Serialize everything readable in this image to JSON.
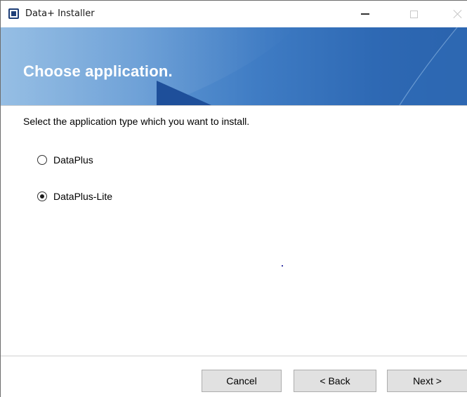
{
  "window": {
    "title": "Data+ Installer"
  },
  "banner": {
    "title": "Choose application."
  },
  "content": {
    "instruction": "Select the application type which you want to install.",
    "options": [
      {
        "label": "DataPlus",
        "selected": false
      },
      {
        "label": "DataPlus-Lite",
        "selected": true
      }
    ]
  },
  "footer": {
    "cancel_label": "Cancel",
    "back_label": "< Back",
    "next_label": "Next >"
  },
  "colors": {
    "banner_light": "#7fb0de",
    "banner_dark": "#2a63ad",
    "button_face": "#e1e1e1",
    "app_icon": "#1f3f78"
  },
  "icons": {
    "app": "installer-app-icon",
    "minimize": "minimize-icon",
    "maximize": "maximize-icon",
    "close": "close-icon"
  }
}
